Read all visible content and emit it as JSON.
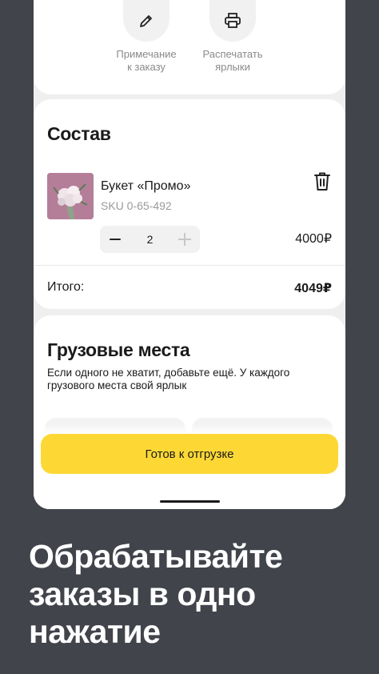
{
  "actions": {
    "note_label": "Примечание\nк заказу",
    "print_label": "Распечатать\nярлыки"
  },
  "order": {
    "title": "Состав",
    "item": {
      "name": "Букет «Промо»",
      "sku": "SKU 0-65-492",
      "quantity": "2",
      "price": "4000₽"
    },
    "total_label": "Итого:",
    "total_value": "4049₽"
  },
  "cargo": {
    "title": "Грузовые места",
    "description": "Если одного не хватит, добавьте ещё. У каждого грузового места свой ярлык"
  },
  "ready_button_label": "Готов к отгрузке",
  "promo_text": "Обрабатывайте заказы в одно нажатие",
  "colors": {
    "background": "#41444b",
    "accent": "#fdd835"
  }
}
